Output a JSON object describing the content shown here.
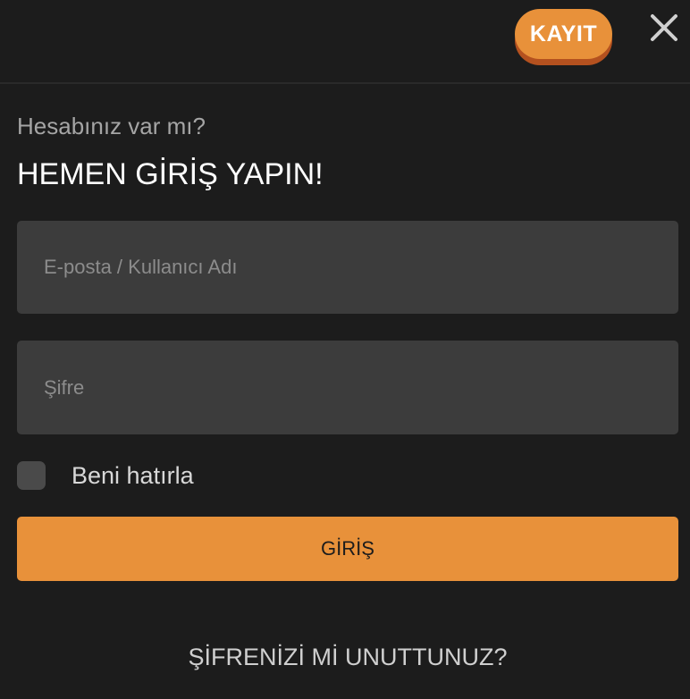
{
  "header": {
    "register_label": "KAYIT",
    "close_icon": "close-icon"
  },
  "intro": {
    "subtitle": "Hesabınız var mı?",
    "title": "HEMEN GİRİŞ YAPIN!"
  },
  "form": {
    "email_placeholder": "E-posta / Kullanıcı Adı",
    "email_value": "",
    "password_placeholder": "Şifre",
    "password_value": "",
    "remember_label": "Beni hatırla",
    "remember_checked": false,
    "login_label": "GİRİŞ"
  },
  "footer": {
    "forgot_label": "ŞİFRENİZİ Mİ UNUTTUNUZ?"
  },
  "colors": {
    "background": "#1c1c1c",
    "accent": "#e8913a",
    "accent_shadow": "#b4511f",
    "field_bg": "#3c3c3c"
  }
}
